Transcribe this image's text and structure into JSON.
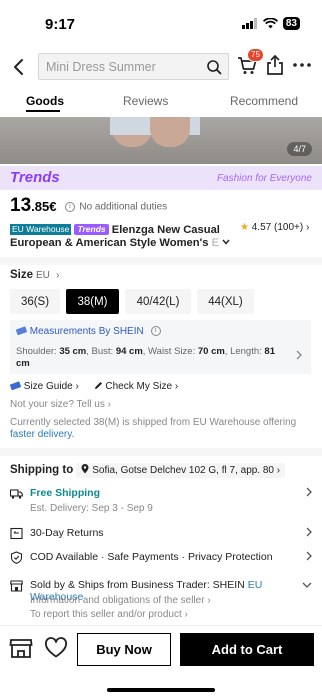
{
  "status": {
    "time": "9:17",
    "battery": "83"
  },
  "search": {
    "placeholder": "Mini Dress Summer"
  },
  "cart": {
    "badge": "75"
  },
  "tabs": [
    "Goods",
    "Reviews",
    "Recommend"
  ],
  "gallery": {
    "indicator": "4/7"
  },
  "trends": {
    "logo": "Trends",
    "tagline": "Fashion for Everyone"
  },
  "price": {
    "main": "13",
    "cents": ".85€",
    "note": "No additional duties"
  },
  "product": {
    "badge_eu": "EU Warehouse",
    "badge_trends": "Trends",
    "title": "Elenzga New Casual European & American Style Women's",
    "title_fade": "E"
  },
  "rating": {
    "value": "4.57",
    "count": "(100+)"
  },
  "size": {
    "label": "Size",
    "unit": "EU",
    "options": [
      "36(S)",
      "38(M)",
      "40/42(L)",
      "44(XL)"
    ],
    "selected_index": 1
  },
  "measurements": {
    "title": "Measurements By SHEIN",
    "shoulder_label": "Shoulder:",
    "shoulder": "35 cm",
    "bust_label": "Bust:",
    "bust": "94 cm",
    "waist_label": "Waist Size:",
    "waist": "70 cm",
    "length_label": "Length:",
    "length": "81 cm"
  },
  "size_links": {
    "guide": "Size Guide",
    "check": "Check My Size",
    "not_size": "Not your size? Tell us"
  },
  "selected_note": {
    "text": "Currently selected 38(M) is shipped from EU Warehouse offering",
    "link": "faster delivery."
  },
  "shipping": {
    "label": "Shipping to",
    "address": "Sofia, Gotse Delchev 102 G, fl 7, app. 80",
    "free": "Free Shipping",
    "delivery": "Est. Delivery: Sep 3 - Sep 9",
    "returns": "30-Day Returns",
    "payments": "COD Available · Safe Payments · Privacy Protection",
    "sold_by": "Sold by & Ships from Business Trader: SHEIN",
    "sold_by_link": "EU Warehouse",
    "seller_info": "Information and obligations of the seller",
    "report": "To report this seller and/or product"
  },
  "actions": {
    "buy_now": "Buy Now",
    "add_to_cart": "Add to Cart"
  },
  "colors": {
    "accent": "#000000",
    "trends_purple": "#8b3dff",
    "eu_teal": "#0e7d99",
    "free_ship": "#0e8a8f",
    "link_blue": "#2a7bb8",
    "badge_red": "#e8452d"
  }
}
